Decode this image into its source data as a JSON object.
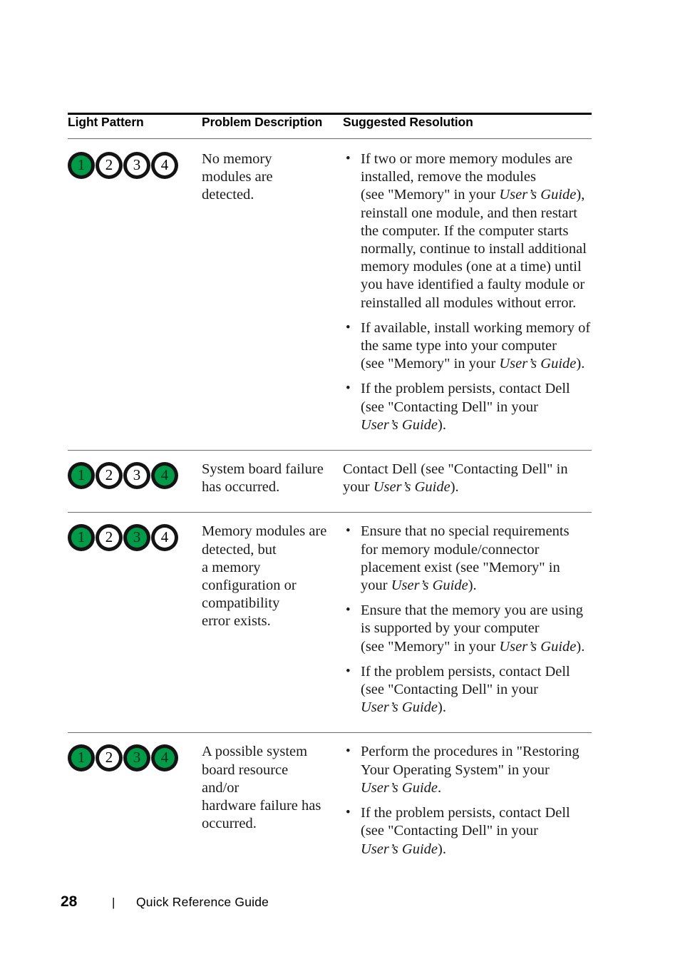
{
  "document": {
    "type": "quick-reference-guide-page",
    "page_number": "28",
    "footer_separator": "|",
    "footer_title": "Quick Reference Guide"
  },
  "table": {
    "headers": {
      "light_pattern": "Light Pattern",
      "problem_description": "Problem Description",
      "suggested_resolution": "Suggested Resolution"
    },
    "led_colors": {
      "on": "#009b48",
      "off": "#ffffff",
      "ring": "#141414"
    },
    "rows": [
      {
        "lights": [
          {
            "label": "1",
            "state": "on"
          },
          {
            "label": "2",
            "state": "off"
          },
          {
            "label": "3",
            "state": "off"
          },
          {
            "label": "4",
            "state": "off"
          }
        ],
        "problem": "No memory\nmodules are detected.",
        "resolution_type": "bullets",
        "resolutions": [
          "If two or more memory modules are\ninstalled, remove the modules\n(see \"Memory\" in your User’s Guide),\nreinstall one module, and then restart\nthe computer. If the computer starts\nnormally, continue to install additional\nmemory modules (one at a time) until\nyou have identified a faulty module or\nreinstalled all modules without error.",
          "If available, install working memory of\nthe same type into your computer\n(see \"Memory\" in your User’s Guide).",
          "If the problem persists, contact Dell\n(see \"Contacting Dell\" in your\nUser’s Guide)."
        ]
      },
      {
        "lights": [
          {
            "label": "1",
            "state": "on"
          },
          {
            "label": "2",
            "state": "off"
          },
          {
            "label": "3",
            "state": "off"
          },
          {
            "label": "4",
            "state": "on"
          }
        ],
        "problem": "System board failure\nhas occurred.",
        "resolution_type": "plain",
        "resolutions": [
          "Contact Dell (see \"Contacting Dell\" in\nyour User’s Guide)."
        ]
      },
      {
        "lights": [
          {
            "label": "1",
            "state": "on"
          },
          {
            "label": "2",
            "state": "off"
          },
          {
            "label": "3",
            "state": "on"
          },
          {
            "label": "4",
            "state": "off"
          }
        ],
        "problem": "Memory modules are\ndetected, but\na memory\nconfiguration or\ncompatibility\nerror exists.",
        "resolution_type": "bullets",
        "resolutions": [
          "Ensure that no special requirements\nfor memory module/connector\nplacement exist (see \"Memory\" in\nyour User’s Guide).",
          "Ensure that the memory you are using\nis supported by your computer\n(see \"Memory\" in your User’s Guide).",
          "If the problem persists, contact Dell\n(see \"Contacting Dell\" in your\nUser’s Guide)."
        ]
      },
      {
        "lights": [
          {
            "label": "1",
            "state": "on"
          },
          {
            "label": "2",
            "state": "off"
          },
          {
            "label": "3",
            "state": "on"
          },
          {
            "label": "4",
            "state": "on"
          }
        ],
        "problem": "A possible system\nboard resource and/or\nhardware failure has\noccurred.",
        "resolution_type": "bullets",
        "resolutions": [
          "Perform the procedures in \"Restoring\nYour Operating System\" in your\nUser’s Guide.",
          "If the problem persists, contact Dell\n(see \"Contacting Dell\" in your\nUser’s Guide)."
        ]
      }
    ]
  },
  "italic_phrases": [
    "User’s Guide"
  ]
}
